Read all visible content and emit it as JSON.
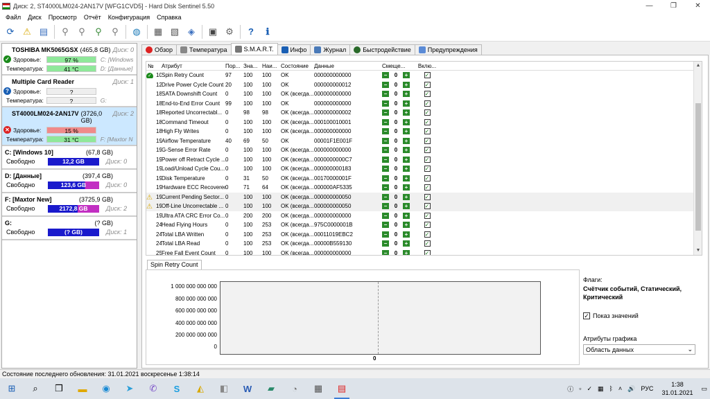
{
  "window": {
    "title": "Диск: 2, ST4000LM024-2AN17V [WFG1CVD5]  -  Hard Disk Sentinel 5.50",
    "min": "—",
    "max": "❐",
    "close": "✕"
  },
  "menu": [
    "Файл",
    "Диск",
    "Просмотр",
    "Отчёт",
    "Конфигурация",
    "Справка"
  ],
  "toolbar_icons": [
    "refresh-icon",
    "warning-icon",
    "disk-info-icon",
    "disk-test-icon",
    "disk-test-2-icon",
    "disk-test-3-icon",
    "disk-test-4-icon",
    "globe-icon",
    "report-icon",
    "report-2-icon",
    "network-icon",
    "monitor-icon",
    "settings-icon",
    "help-icon",
    "info-icon"
  ],
  "disks": [
    {
      "name": "TOSHIBA MK5065GSX",
      "size": "(465,8 GB)",
      "disk": "Диск: 0",
      "health_label": "Здоровье:",
      "health": "97 %",
      "health_color": "#8fe89a",
      "health_extra": "C: [Windows",
      "temp_label": "Температура:",
      "temp": "41 °C",
      "temp_color": "#8fe89a",
      "temp_extra": "D: [Данные]",
      "status": "ok"
    },
    {
      "name": "Multiple Card  Reader",
      "size": "",
      "disk": "Диск: 1",
      "health_label": "Здоровье:",
      "health": "?",
      "health_color": "#eeeeee",
      "health_extra": "",
      "temp_label": "Температура:",
      "temp": "?",
      "temp_color": "#eeeeee",
      "temp_extra": "G:",
      "status": "unknown"
    },
    {
      "name": "ST4000LM024-2AN17V",
      "size": "(3726,0 GB)",
      "disk": "Диск: 2",
      "health_label": "Здоровье:",
      "health": "15 %",
      "health_color": "#f08a8a",
      "health_extra": "",
      "temp_label": "Температура:",
      "temp": "31 °C",
      "temp_color": "#8fe89a",
      "temp_extra": "F: [Maxtor N",
      "status": "bad"
    }
  ],
  "volumes": [
    {
      "name": "C: [Windows 10]",
      "size": "(67,8 GB)",
      "free_label": "Свободно",
      "free": "12,2 GB",
      "bar_color": "#1a1acc",
      "disk": "Диск: 0"
    },
    {
      "name": "D: [Данные]",
      "size": "(397,4 GB)",
      "free_label": "Свободно",
      "free": "123,6 GB",
      "bar_color": "#1a1acc",
      "disk": "Диск: 0"
    },
    {
      "name": "F: [Maxtor New]",
      "size": "(3725,9 GB)",
      "free_label": "Свободно",
      "free": "2172,8 GB",
      "bar_color": "#c22fc2",
      "disk": "Диск: 2"
    },
    {
      "name": "G:",
      "size": "(? GB)",
      "free_label": "Свободно",
      "free": "(? GB)",
      "bar_color": "#1a1acc",
      "disk": "Диск: 1"
    }
  ],
  "tabs": [
    {
      "label": "Обзор",
      "icon": "overview-icon",
      "color": "#d22"
    },
    {
      "label": "Температура",
      "icon": "temperature-icon",
      "color": "#888"
    },
    {
      "label": "S.M.A.R.T.",
      "icon": "smart-icon",
      "color": "#666",
      "active": true
    },
    {
      "label": "Инфо",
      "icon": "info-icon",
      "color": "#1a5fb4"
    },
    {
      "label": "Журнал",
      "icon": "log-icon",
      "color": "#4a7ab8"
    },
    {
      "label": "Быстродействие",
      "icon": "performance-icon",
      "color": "#2a6a2a"
    },
    {
      "label": "Предупреждения",
      "icon": "alerts-icon",
      "color": "#5b8bd6"
    }
  ],
  "table": {
    "headers": [
      "№",
      "Атрибут",
      "Пор...",
      "Зна...",
      "Наи...",
      "Состояние",
      "Данные",
      "Смеще...",
      "Вклю..."
    ],
    "rows": [
      [
        "10",
        "Spin Retry Count",
        "97",
        "100",
        "100",
        "OK",
        "000000000000",
        "0",
        "ok-icon"
      ],
      [
        "12",
        "Drive Power Cycle Count",
        "20",
        "100",
        "100",
        "OK",
        "000000000012",
        "0",
        ""
      ],
      [
        "183",
        "SATA Downshift Count",
        "0",
        "100",
        "100",
        "OK (всегда...",
        "000000000000",
        "0",
        ""
      ],
      [
        "184",
        "End-to-End Error Count",
        "99",
        "100",
        "100",
        "OK",
        "000000000000",
        "0",
        ""
      ],
      [
        "187",
        "Reported Uncorrectabl...",
        "0",
        "98",
        "98",
        "OK (всегда...",
        "000000000002",
        "0",
        ""
      ],
      [
        "188",
        "Command Timeout",
        "0",
        "100",
        "100",
        "OK (всегда...",
        "000100010001",
        "0",
        ""
      ],
      [
        "189",
        "High Fly Writes",
        "0",
        "100",
        "100",
        "OK (всегда...",
        "000000000000",
        "0",
        ""
      ],
      [
        "190",
        "Airflow Temperature",
        "40",
        "69",
        "50",
        "OK",
        "00001F1E001F",
        "0",
        ""
      ],
      [
        "191",
        "G-Sense Error Rate",
        "0",
        "100",
        "100",
        "OK (всегда...",
        "000000000000",
        "0",
        ""
      ],
      [
        "192",
        "Power off Retract Cycle ...",
        "0",
        "100",
        "100",
        "OK (всегда...",
        "0000000000C7",
        "0",
        ""
      ],
      [
        "193",
        "Load/Unload Cycle Cou...",
        "0",
        "100",
        "100",
        "OK (всегда...",
        "000000000183",
        "0",
        ""
      ],
      [
        "194",
        "Disk Temperature",
        "0",
        "31",
        "50",
        "OK (всегда...",
        "00170000001F",
        "0",
        ""
      ],
      [
        "195",
        "Hardware ECC Recovered",
        "0",
        "71",
        "64",
        "OK (всегда...",
        "000000AF5335",
        "0",
        ""
      ],
      [
        "197",
        "Current Pending Sector...",
        "0",
        "100",
        "100",
        "OK (всегда...",
        "000000000050",
        "0",
        "warn-icon"
      ],
      [
        "198",
        "Off-Line Uncorrectable ...",
        "0",
        "100",
        "100",
        "OK (всегда...",
        "000000000050",
        "0",
        "warn-icon"
      ],
      [
        "199",
        "Ultra ATA CRC Error Co...",
        "0",
        "200",
        "200",
        "OK (всегда...",
        "000000000000",
        "0",
        ""
      ],
      [
        "240",
        "Head Flying Hours",
        "0",
        "100",
        "253",
        "OK (всегда...",
        "975C0000001B",
        "0",
        ""
      ],
      [
        "241",
        "Total LBA Written",
        "0",
        "100",
        "253",
        "OK (всегда...",
        "00011019EBC2",
        "0",
        ""
      ],
      [
        "242",
        "Total LBA Read",
        "0",
        "100",
        "253",
        "OK (всегда...",
        "00000B559130",
        "0",
        ""
      ],
      [
        "254",
        "Free Fall Event Count",
        "0",
        "100",
        "100",
        "OK (всегда...",
        "000000000000",
        "0",
        ""
      ]
    ]
  },
  "graph": {
    "tab": "Spin Retry Count",
    "yticks": [
      "1 000 000 000 000",
      "800 000 000 000",
      "600 000 000 000",
      "400 000 000 000",
      "200 000 000 000",
      "0"
    ],
    "xlabel": "0"
  },
  "side": {
    "flags_label": "Флаги:",
    "flags_value": "Счётчик событий, Статический, Критический",
    "show_values": "Показ значений",
    "attr_label": "Атрибуты графика",
    "attr_select": "Область данных"
  },
  "status": "Состояние последнего обновления: 31.01.2021 воскресенье 1:38:14",
  "taskbar": {
    "icons": [
      "windows-start-icon",
      "search-icon",
      "task-view-icon",
      "file-explorer-icon",
      "edge-icon",
      "telegram-icon",
      "viber-icon",
      "skype-icon",
      "norton-icon",
      "folder-icon",
      "word-icon",
      "notepad-icon",
      "gimp-icon",
      "calculator-icon",
      "hdsentinel-icon"
    ],
    "lang": "РУС",
    "time": "1:38",
    "date": "31.01.2021"
  }
}
